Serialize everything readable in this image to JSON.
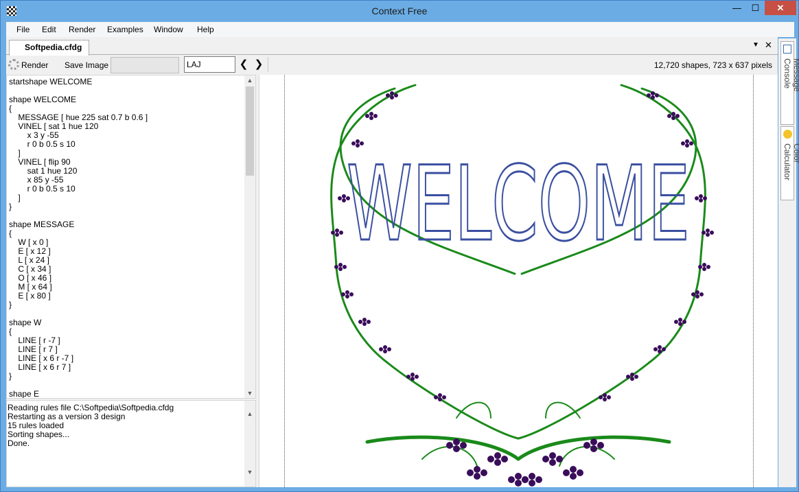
{
  "window": {
    "title": "Context Free",
    "min_glyph": "—",
    "max_glyph": "☐",
    "close_glyph": "✕"
  },
  "menu": {
    "items": [
      "File",
      "Edit",
      "Render",
      "Examples",
      "Window",
      "Help"
    ]
  },
  "tabs": {
    "active": "Softpedia.cfdg",
    "dropdown_glyph": "▼",
    "close_glyph": "✕"
  },
  "toolbar": {
    "render_label": "Render",
    "save_label": "Save Image",
    "variation_value": "LAJ",
    "prev_glyph": "❮",
    "next_glyph": "❯",
    "status": "12,720 shapes, 723 x 637 pixels"
  },
  "editor": {
    "code": "startshape WELCOME\n\nshape WELCOME\n{\n    MESSAGE [ hue 225 sat 0.7 b 0.6 ]\n    VINEL [ sat 1 hue 120\n        x 3 y -55\n        r 0 b 0.5 s 10\n    ]\n    VINEL [ flip 90\n        sat 1 hue 120\n        x 85 y -55\n        r 0 b 0.5 s 10\n    ]\n}\n\nshape MESSAGE\n{\n    W [ x 0 ]\n    E [ x 12 ]\n    L [ x 24 ]\n    C [ x 34 ]\n    O [ x 46 ]\n    M [ x 64 ]\n    E [ x 80 ]\n}\n\nshape W\n{\n    LINE [ r -7 ]\n    LINE [ r 7 ]\n    LINE [ x 6 r -7 ]\n    LINE [ x 6 r 7 ]\n}\n\nshape E"
  },
  "console": {
    "text": "Reading rules file C:\\Softpedia\\Softpedia.cfdg\nRestarting as a version 3 design\n15 rules loaded\nSorting shapes...\nDone."
  },
  "canvas": {
    "word": "WELCOME",
    "word_color": "#3a4fa0",
    "vine_color": "#1a8a1a",
    "grape_color": "#3a0d5a"
  },
  "sidepanel": {
    "tabs": [
      "Message Console",
      "Color Calculator"
    ]
  }
}
